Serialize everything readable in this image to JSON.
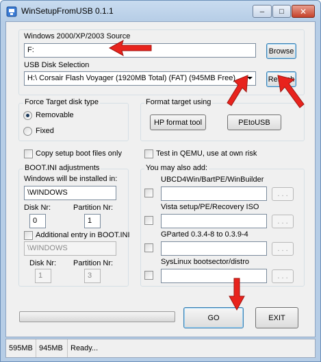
{
  "window": {
    "title": "WinSetupFromUSB 0.1.1",
    "minimize_glyph": "─",
    "maximize_glyph": "□",
    "close_glyph": "✕"
  },
  "source": {
    "label": "Windows 2000/XP/2003 Source",
    "value": "F:",
    "browse_label": "Browse"
  },
  "usb": {
    "label": "USB Disk Selection",
    "value": "H:\\ Corsair Flash Voyager (1920MB Total) (FAT) (945MB Free)",
    "refresh_label": "Refresh"
  },
  "force_target": {
    "label": "Force Target disk type",
    "removable_label": "Removable",
    "fixed_label": "Fixed",
    "selected": "Removable"
  },
  "format_target": {
    "label": "Format target using",
    "hp_label": "HP format tool",
    "petousb_label": "PEtoUSB"
  },
  "options": {
    "copy_boot_label": "Copy setup boot files only",
    "qemu_label": "Test in QEMU, use at own risk"
  },
  "bootini": {
    "label": "BOOT.INI adjustments",
    "installed_label": "Windows will be installed in:",
    "installed_value": "\\WINDOWS",
    "disk_label": "Disk Nr:",
    "disk_value": "0",
    "partition_label": "Partition Nr:",
    "partition_value": "1",
    "additional_label": "Additional entry in BOOT.INI",
    "additional_value": "\\WINDOWS",
    "disk2_label": "Disk Nr:",
    "disk2_value": "1",
    "partition2_label": "Partition Nr:",
    "partition2_value": "3"
  },
  "also_add": {
    "label": "You may also add:",
    "ellipsis_label": ". . .",
    "items": [
      {
        "label": "UBCD4Win/BartPE/WinBuilder"
      },
      {
        "label": "Vista setup/PE/Recovery ISO"
      },
      {
        "label": "GParted 0.3.4-8 to 0.3.9-4"
      },
      {
        "label": "SysLinux bootsector/distro"
      }
    ]
  },
  "actions": {
    "go_label": "GO",
    "exit_label": "EXIT"
  },
  "status": {
    "cell1": "595MB",
    "cell2": "945MB",
    "cell3": "Ready..."
  },
  "colors": {
    "annotation_arrow": "#e8231d"
  }
}
